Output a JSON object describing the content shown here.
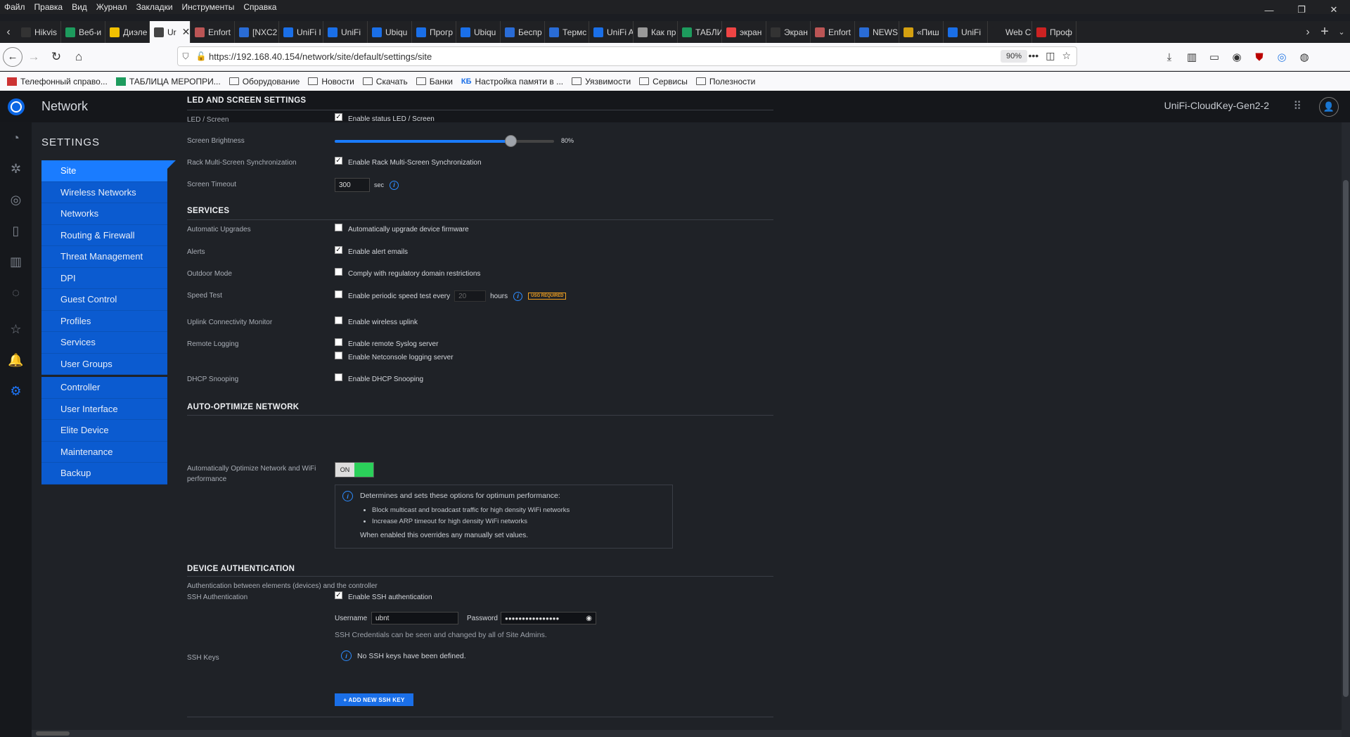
{
  "browser": {
    "menu": [
      "Файл",
      "Правка",
      "Вид",
      "Журнал",
      "Закладки",
      "Инструменты",
      "Справка"
    ],
    "window_controls": {
      "minimize": "—",
      "maximize": "❐",
      "close": "✕"
    },
    "tabs": [
      {
        "label": "Hikvis",
        "color": "#333"
      },
      {
        "label": "Веб-и",
        "color": "#1d9b5d"
      },
      {
        "label": "Диэле",
        "color": "#f2c100"
      },
      {
        "label": "Ur",
        "color": "#444",
        "active": true
      },
      {
        "label": "Enfort",
        "color": "#b55"
      },
      {
        "label": "[NXC2",
        "color": "#2a6cd6"
      },
      {
        "label": "UniFi I",
        "color": "#1a6fe8"
      },
      {
        "label": "UniFi",
        "color": "#1a6fe8"
      },
      {
        "label": "Ubiqu",
        "color": "#1a6fe8"
      },
      {
        "label": "Прогр",
        "color": "#1a6fe8"
      },
      {
        "label": "Ubiqu",
        "color": "#1a6fe8"
      },
      {
        "label": "Беспр",
        "color": "#2a6cd6"
      },
      {
        "label": "Термс",
        "color": "#2a6cd6"
      },
      {
        "label": "UniFi A",
        "color": "#1a6fe8"
      },
      {
        "label": "Как пр",
        "color": "#999"
      },
      {
        "label": "ТАБЛИ",
        "color": "#1d9b5d"
      },
      {
        "label": "экран",
        "color": "#e44"
      },
      {
        "label": "Экран",
        "color": "#333"
      },
      {
        "label": "Enfort",
        "color": "#b55"
      },
      {
        "label": "NEWS",
        "color": "#2a6cd6"
      },
      {
        "label": "«Пиш",
        "color": "#d4a010"
      },
      {
        "label": "UniFi",
        "color": "#1a6fe8"
      },
      {
        "label": "Web Conf",
        "color": "#202124"
      },
      {
        "label": "Проф",
        "color": "#c22"
      }
    ],
    "url": "https://192.168.40.154/network/site/default/settings/site",
    "zoom": "90%",
    "bookmarks": [
      {
        "label": "Телефонный справо...",
        "type": "icon",
        "color": "#c33"
      },
      {
        "label": "ТАБЛИЦА МЕРОПРИ...",
        "type": "icon",
        "color": "#1d9b5d"
      },
      {
        "label": "Оборудование",
        "type": "folder"
      },
      {
        "label": "Новости",
        "type": "folder"
      },
      {
        "label": "Скачать",
        "type": "folder"
      },
      {
        "label": "Банки",
        "type": "folder"
      },
      {
        "label": "Настройка памяти в ...",
        "type": "kb",
        "color": "#1a6fe8"
      },
      {
        "label": "Уязвимости",
        "type": "folder"
      },
      {
        "label": "Сервисы",
        "type": "folder"
      },
      {
        "label": "Полезности",
        "type": "folder"
      }
    ]
  },
  "app": {
    "title": "Network",
    "device_name": "UniFi-CloudKey-Gen2-2",
    "settings_title": "SETTINGS",
    "subnav_group1": [
      "Site",
      "Wireless Networks",
      "Networks",
      "Routing & Firewall",
      "Threat Management",
      "DPI",
      "Guest Control",
      "Profiles",
      "Services",
      "User Groups"
    ],
    "subnav_group2": [
      "Controller",
      "User Interface",
      "Elite Device",
      "Maintenance",
      "Backup"
    ]
  },
  "led": {
    "section": "LED AND SCREEN SETTINGS",
    "led_label": "LED / Screen",
    "led_check": "Enable status LED / Screen",
    "brightness_label": "Screen Brightness",
    "brightness_value": "80%",
    "brightness_fraction": 0.8,
    "rack_label": "Rack Multi-Screen Synchronization",
    "rack_check": "Enable Rack Multi-Screen Synchronization",
    "timeout_label": "Screen Timeout",
    "timeout_value": "300",
    "timeout_unit": "sec"
  },
  "services": {
    "section": "SERVICES",
    "auto_upgrade_label": "Automatic Upgrades",
    "auto_upgrade_check": "Automatically upgrade device firmware",
    "alerts_label": "Alerts",
    "alerts_check": "Enable alert emails",
    "outdoor_label": "Outdoor Mode",
    "outdoor_check": "Comply with regulatory domain restrictions",
    "speed_label": "Speed Test",
    "speed_check": "Enable periodic speed test every",
    "speed_value": "20",
    "speed_unit": "hours",
    "usg_badge": "USG REQUIRED",
    "uplink_label": "Uplink Connectivity Monitor",
    "uplink_check": "Enable wireless uplink",
    "remote_label": "Remote Logging",
    "remote_check1": "Enable remote Syslog server",
    "remote_check2": "Enable Netconsole logging server",
    "dhcp_label": "DHCP Snooping",
    "dhcp_check": "Enable DHCP Snooping"
  },
  "auto_opt": {
    "section": "AUTO-OPTIMIZE NETWORK",
    "label": "Automatically Optimize Network and WiFi performance",
    "toggle": "ON",
    "info_title": "Determines and sets these options for optimum performance:",
    "bullets": [
      "Block multicast and broadcast traffic for high density WiFi networks",
      "Increase ARP timeout for high density WiFi networks"
    ],
    "info_footer": "When enabled this overrides any manually set values."
  },
  "device_auth": {
    "section": "DEVICE AUTHENTICATION",
    "subtitle": "Authentication between elements (devices) and the controller",
    "ssh_label": "SSH Authentication",
    "ssh_check": "Enable SSH authentication",
    "username_label": "Username",
    "username_value": "ubnt",
    "password_label": "Password",
    "password_value": "●●●●●●●●●●●●●●●●",
    "cred_note": "SSH Credentials can be seen and changed by all of Site Admins.",
    "keys_label": "SSH Keys",
    "keys_empty": "No SSH keys have been defined.",
    "add_key": "+ ADD NEW SSH KEY"
  }
}
